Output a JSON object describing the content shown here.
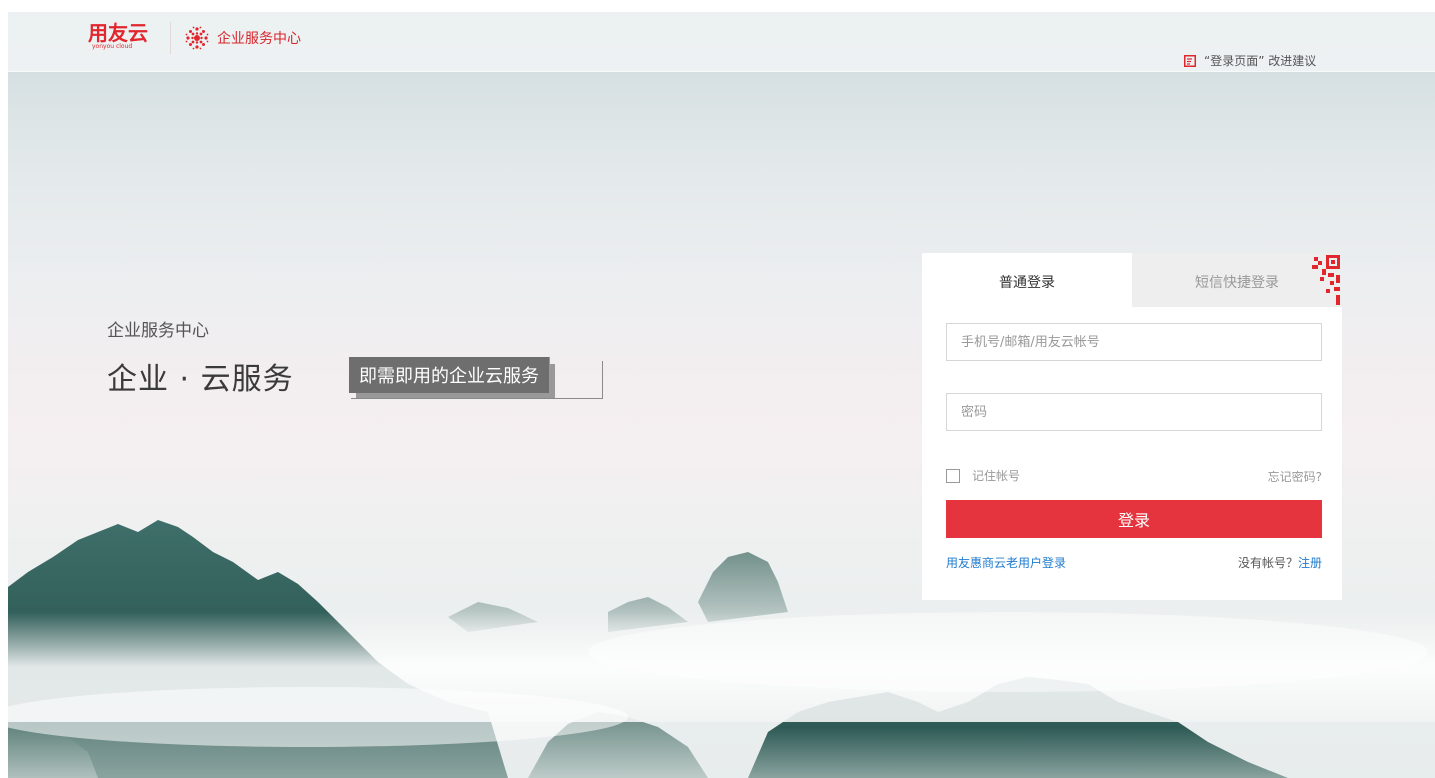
{
  "header": {
    "logo_text": "用友云",
    "logo_subtext": "yonyou cloud",
    "brand_title": "企业服务中心",
    "feedback_text": "“登录页面” 改进建议"
  },
  "hero": {
    "subtitle": "企业服务中心",
    "title": "企业 · 云服务",
    "tagline": "即需即用的企业云服务"
  },
  "login": {
    "tabs": [
      {
        "label": "普通登录",
        "active": true
      },
      {
        "label": "短信快捷登录",
        "active": false
      }
    ],
    "account_placeholder": "手机号/邮箱/用友云帐号",
    "account_value": "",
    "password_placeholder": "密码",
    "password_value": "",
    "remember_label": "记住帐号",
    "remember_checked": false,
    "forgot_label": "忘记密码?",
    "submit_label": "登录",
    "old_user_login": "用友惠商云老用户登录",
    "no_account_text": "没有帐号？",
    "register_label": "注册"
  },
  "colors": {
    "brand_red": "#e1262d",
    "button_red": "#e5343e",
    "link_blue": "#1f7bcf"
  }
}
